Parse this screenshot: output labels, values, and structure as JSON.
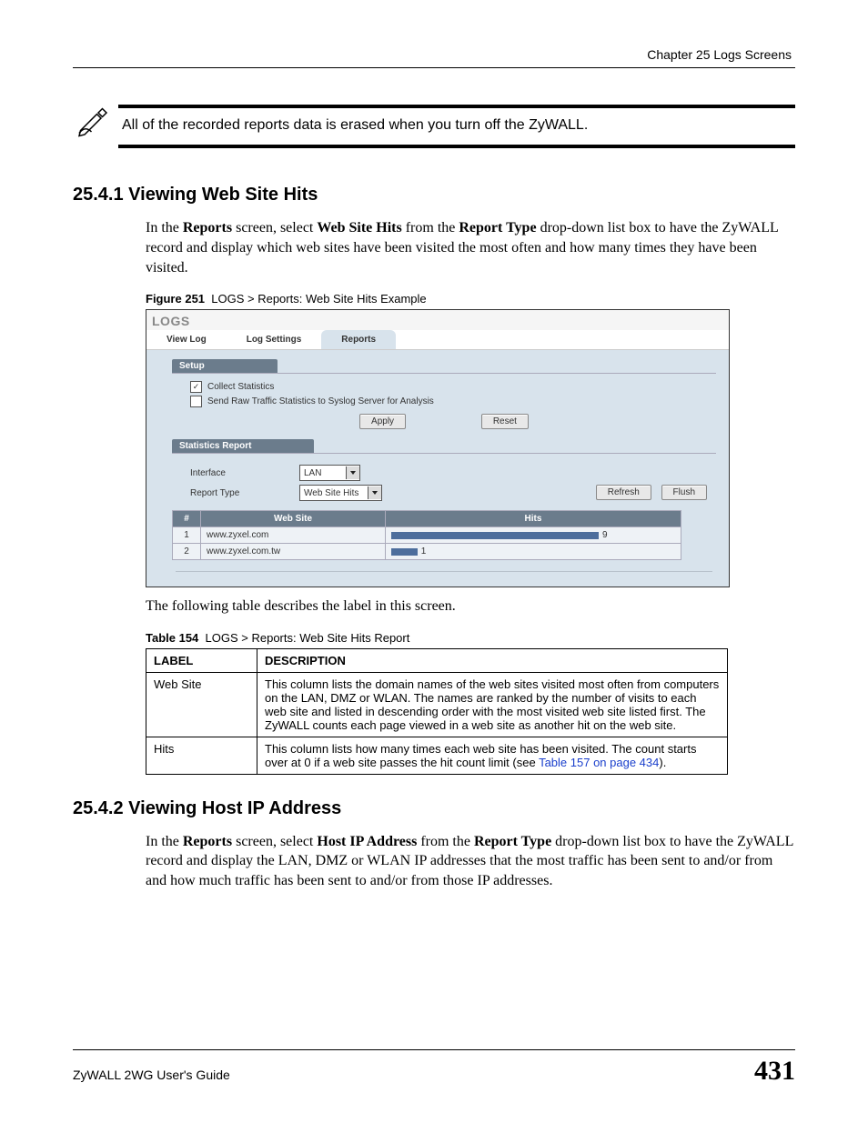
{
  "chapter_header": "Chapter 25 Logs Screens",
  "note_text": "All of the recorded reports data is erased when you turn off the ZyWALL.",
  "section_2541": {
    "heading": "25.4.1  Viewing Web Site Hits",
    "para_parts": {
      "p1": "In the ",
      "b1": "Reports",
      "p2": " screen, select ",
      "b2": "Web Site Hits",
      "p3": " from the ",
      "b3": "Report Type",
      "p4": " drop-down list box to have the ZyWALL record and display which web sites have been visited the most often and how many times they have been visited."
    }
  },
  "figure251": {
    "label": "Figure 251",
    "caption": "LOGS > Reports: Web Site Hits Example"
  },
  "screenshot": {
    "title": "LOGS",
    "tabs": [
      "View Log",
      "Log Settings",
      "Reports"
    ],
    "active_tab_index": 2,
    "setup": {
      "heading": "Setup",
      "collect_stats": {
        "label": "Collect Statistics",
        "checked": true
      },
      "send_syslog": {
        "label": "Send Raw Traffic Statistics to Syslog Server for Analysis",
        "checked": false
      },
      "apply_btn": "Apply",
      "reset_btn": "Reset"
    },
    "stats": {
      "heading": "Statistics Report",
      "interface_label": "Interface",
      "interface_value": "LAN",
      "report_type_label": "Report Type",
      "report_type_value": "Web Site Hits",
      "refresh_btn": "Refresh",
      "flush_btn": "Flush",
      "columns": {
        "num": "#",
        "site": "Web Site",
        "hits": "Hits"
      },
      "rows": [
        {
          "n": "1",
          "site": "www.zyxel.com",
          "hits": "9",
          "bar_pct": 95
        },
        {
          "n": "2",
          "site": "www.zyxel.com.tw",
          "hits": "1",
          "bar_pct": 12
        }
      ]
    }
  },
  "after_figure_para": "The following table describes the label in this screen.",
  "table154": {
    "label": "Table 154",
    "caption": "LOGS > Reports: Web Site Hits Report",
    "head_label": "LABEL",
    "head_desc": "DESCRIPTION",
    "rows": [
      {
        "label": "Web Site",
        "desc": "This column lists the domain names of the web sites visited most often from computers on the LAN, DMZ or WLAN. The names are ranked by the number of visits to each web site and listed in descending order with the most visited web site listed first. The ZyWALL counts each page viewed in a web site as another hit on the web site."
      },
      {
        "label": "Hits",
        "desc_pre": "This column lists how many times each web site has been visited. The count starts over at 0 if a web site passes the hit count limit (see ",
        "xref": "Table 157 on page 434",
        "desc_post": ")."
      }
    ]
  },
  "section_2542": {
    "heading": "25.4.2  Viewing Host IP Address",
    "para_parts": {
      "p1": "In the ",
      "b1": "Reports",
      "p2": " screen, select ",
      "b2": "Host IP Address",
      "p3": " from the ",
      "b3": "Report Type",
      "p4": " drop-down list box to have the ZyWALL record and display the LAN, DMZ or WLAN IP addresses that the most traffic has been sent to and/or from and how much traffic has been sent to and/or from those IP addresses."
    }
  },
  "footer": {
    "guide": "ZyWALL 2WG User's Guide",
    "page": "431"
  }
}
